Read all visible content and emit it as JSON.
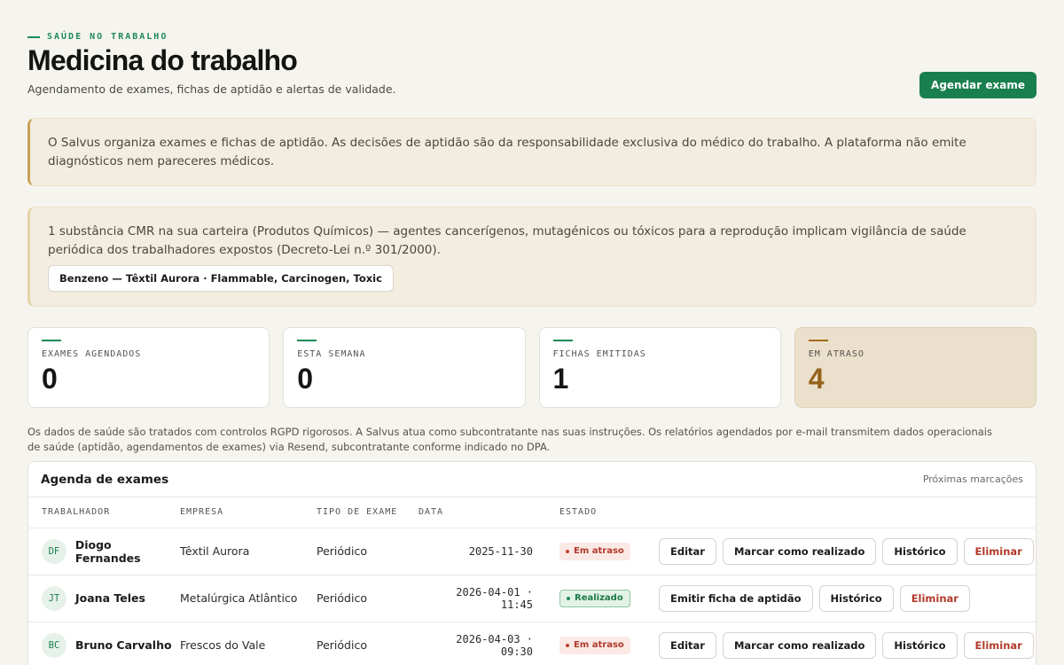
{
  "header": {
    "eyebrow": "SAÚDE NO TRABALHO",
    "title": "Medicina do trabalho",
    "subtitle": "Agendamento de exames, fichas de aptidão e alertas de validade.",
    "primary_action": "Agendar exame"
  },
  "notices": {
    "disclaimer": "O Salvus organiza exames e fichas de aptidão. As decisões de aptidão são da responsabilidade exclusiva do médico do trabalho. A plataforma não emite diagnósticos nem pareceres médicos.",
    "cmr_alert": "1 substância CMR na sua carteira (Produtos Químicos) — agentes cancerígenos, mutagénicos ou tóxicos para a reprodução implicam vigilância de saúde periódica dos trabalhadores expostos (Decreto-Lei n.º 301/2000).",
    "cmr_chip": "Benzeno — Têxtil Aurora · Flammable, Carcinogen, Toxic"
  },
  "stats": [
    {
      "label": "EXAMES AGENDADOS",
      "value": "0"
    },
    {
      "label": "ESTA SEMANA",
      "value": "0"
    },
    {
      "label": "FICHAS EMITIDAS",
      "value": "1"
    },
    {
      "label": "EM ATRASO",
      "value": "4"
    }
  ],
  "rgpd_note": "Os dados de saúde são tratados com controlos RGPD rigorosos. A Salvus atua como subcontratante nas suas instruções. Os relatórios agendados por e-mail transmitem dados operacionais de saúde (aptidão, agendamentos de exames) via Resend, subcontratante conforme indicado no DPA.",
  "agenda": {
    "title": "Agenda de exames",
    "subtitle": "Próximas marcações",
    "columns": [
      "TRABALHADOR",
      "EMPRESA",
      "TIPO DE EXAME",
      "DATA",
      "ESTADO"
    ],
    "rows": [
      {
        "initials": "DF",
        "name": "Diogo Fernandes",
        "company": "Têxtil Aurora",
        "type": "Periódico",
        "date": "2025-11-30",
        "status": "Em atraso",
        "actions": [
          "Editar",
          "Marcar como realizado",
          "Histórico",
          "Eliminar"
        ]
      },
      {
        "initials": "JT",
        "name": "Joana Teles",
        "company": "Metalúrgica Atlântico",
        "type": "Periódico",
        "date": "2026-04-01 · 11:45",
        "status": "Realizado",
        "actions": [
          "Emitir ficha de aptidão",
          "Histórico",
          "Eliminar"
        ]
      },
      {
        "initials": "BC",
        "name": "Bruno Carvalho",
        "company": "Frescos do Vale",
        "type": "Periódico",
        "date": "2026-04-03 · 09:30",
        "status": "Em atraso",
        "actions": [
          "Editar",
          "Marcar como realizado",
          "Histórico",
          "Eliminar"
        ]
      }
    ]
  },
  "colors": {
    "accent": "#1a7f4e",
    "warning": "#96621a",
    "danger": "#b13a2a"
  }
}
